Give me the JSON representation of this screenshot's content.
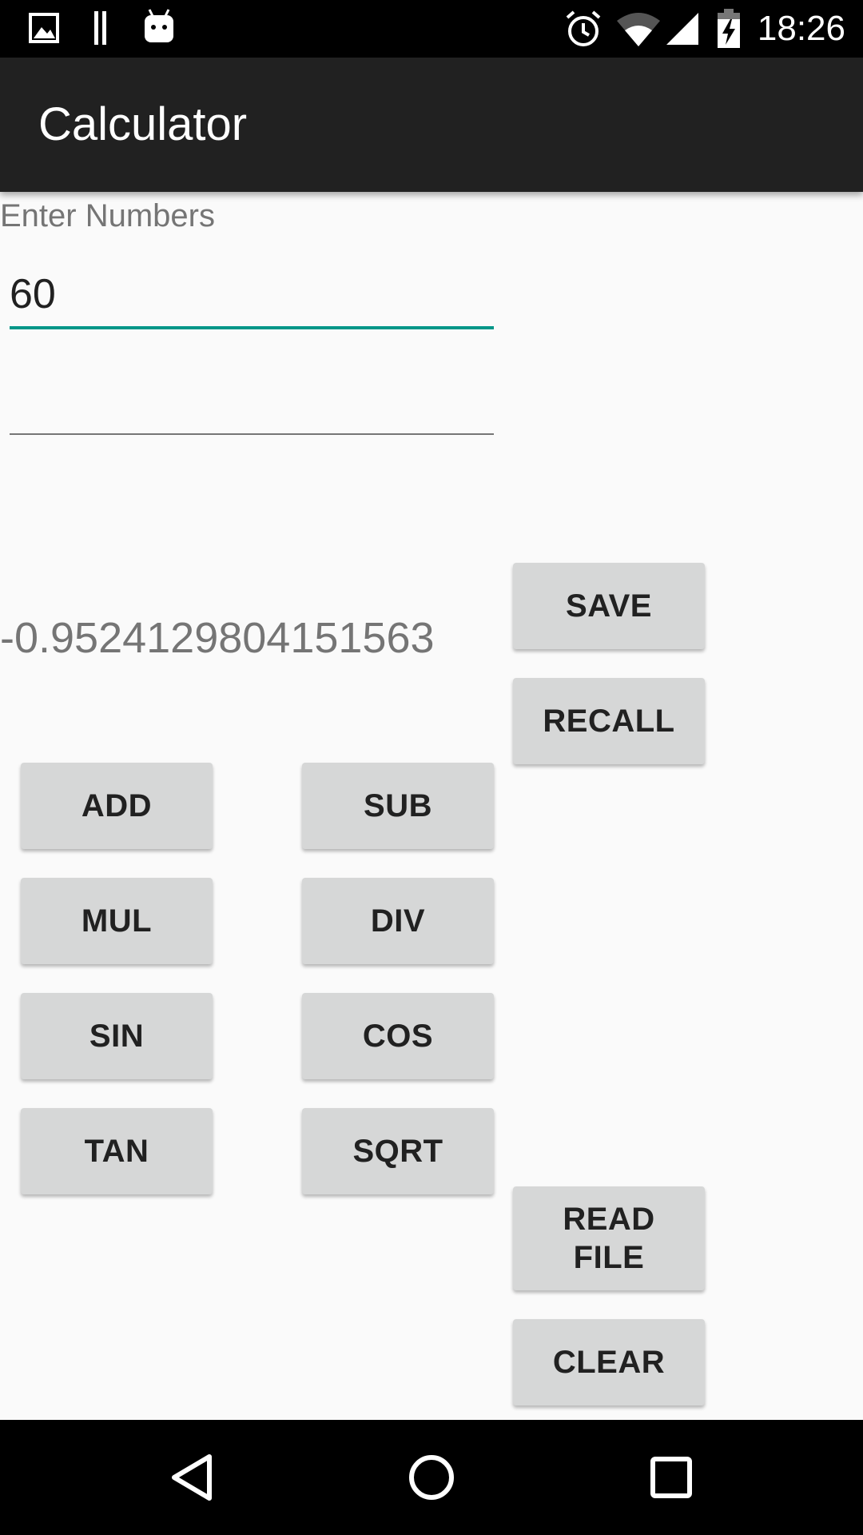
{
  "status_bar": {
    "time": "18:26",
    "left_icons": [
      "image-icon",
      "pause-bars-icon",
      "android-icon"
    ],
    "right_icons": [
      "alarm-icon",
      "wifi-icon",
      "signal-icon",
      "battery-charging-icon"
    ]
  },
  "app_bar": {
    "title": "Calculator"
  },
  "form": {
    "hint_label": "Enter Numbers",
    "first_number_value": "60",
    "second_number_value": "",
    "result": "-0.9524129804151563"
  },
  "buttons": {
    "save": "SAVE",
    "recall": "RECALL",
    "add": "ADD",
    "sub": "SUB",
    "mul": "MUL",
    "div": "DIV",
    "sin": "SIN",
    "cos": "COS",
    "tan": "TAN",
    "sqrt": "SQRT",
    "read_file": "READ FILE",
    "clear": "CLEAR"
  },
  "nav_bar": {
    "icons": [
      "back-icon",
      "home-icon",
      "recents-icon"
    ]
  },
  "colors": {
    "accent": "#009688",
    "app_bar": "#212121",
    "button_bg": "#d6d7d7",
    "background": "#fafafa"
  }
}
